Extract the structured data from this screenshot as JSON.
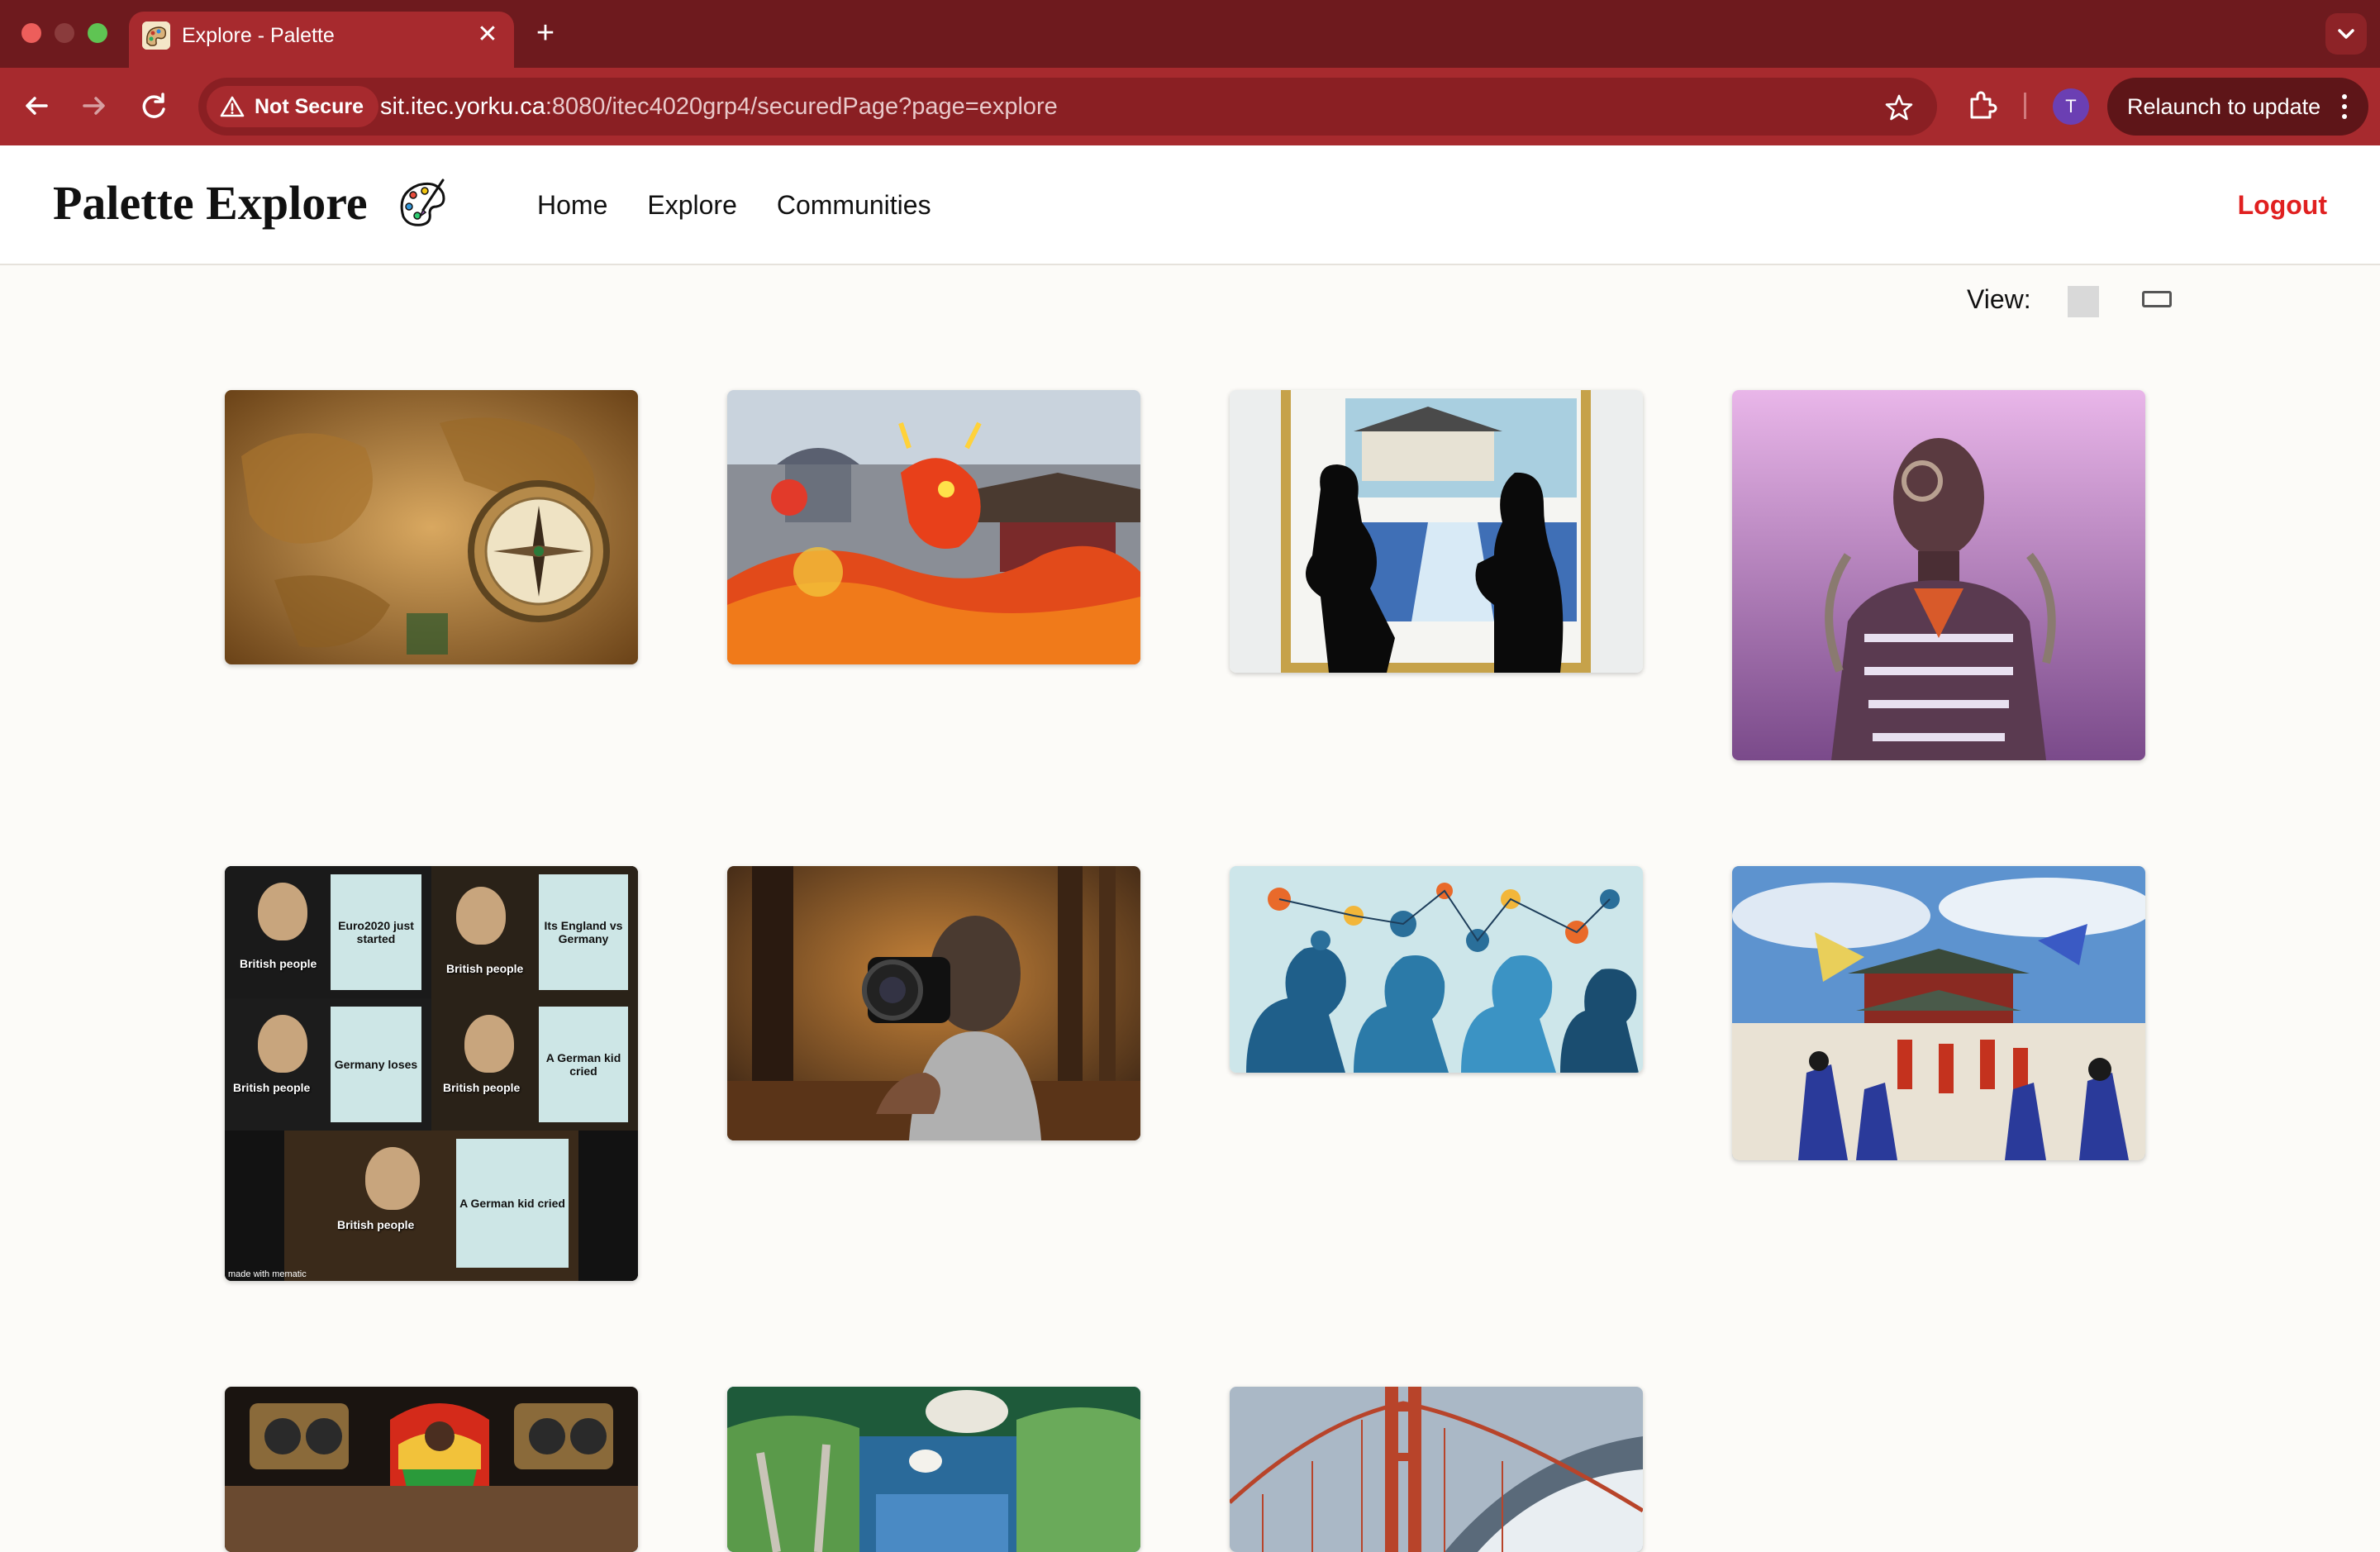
{
  "browser": {
    "tab_title": "Explore - Palette",
    "tab_close": "✕",
    "new_tab": "+",
    "security_label": "Not Secure",
    "url_host": "sit.itec.yorku.ca",
    "url_path": ":8080/itec4020grp4/securedPage?page=explore",
    "profile_initial": "T",
    "relaunch_label": "Relaunch to update"
  },
  "site": {
    "brand": "Palette Explore",
    "nav": [
      "Home",
      "Explore",
      "Communities"
    ],
    "logout": "Logout",
    "view_label": "View:"
  },
  "gallery": {
    "items": [
      {
        "subject": "antique world map with compass"
      },
      {
        "subject": "chinese dragon dance parade"
      },
      {
        "subject": "two silhouettes talking before painting"
      },
      {
        "subject": "cyborg man portrait in purple light"
      },
      {
        "subject": "gru plan meme",
        "meme": {
          "signs": [
            "Euro2020 just started",
            "Its England vs Germany",
            "Germany loses",
            "A German kid cried",
            "A German kid cried"
          ],
          "person": "British people",
          "footer": "made with mematic"
        }
      },
      {
        "subject": "person tossing camera in autumn forest"
      },
      {
        "subject": "heads with network icons illustration"
      },
      {
        "subject": "korean palace guard ceremony"
      },
      {
        "subject": "music mural with speakers"
      },
      {
        "subject": "park with floating objects"
      },
      {
        "subject": "golden gate bridge"
      }
    ]
  },
  "colors": {
    "chrome_dark": "#6e1a1e",
    "chrome_toolbar": "#a72a2e",
    "logout_red": "#e02020",
    "page_bg": "#fcfbf8"
  }
}
